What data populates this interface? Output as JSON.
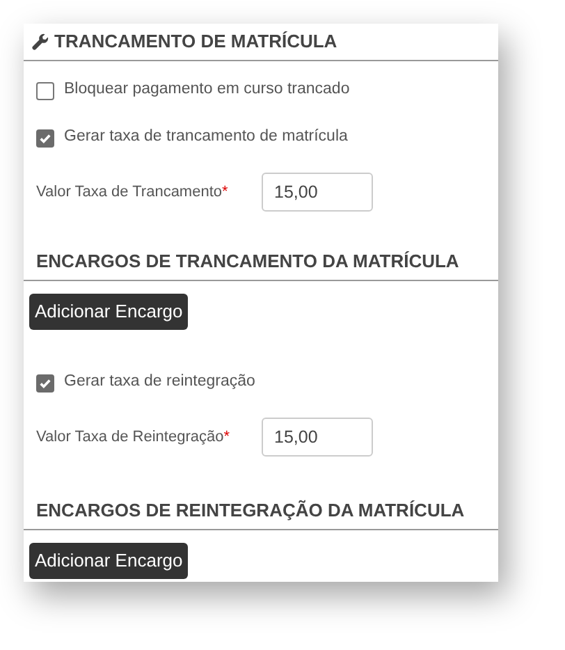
{
  "sections": [
    {
      "title": "TRANCAMENTO DE MATRÍCULA",
      "has_icon": true,
      "items": [
        {
          "kind": "checkbox",
          "label": "Bloquear pagamento em curso trancado",
          "checked": false
        },
        {
          "kind": "checkbox",
          "label": "Gerar taxa de trancamento de matrícula",
          "checked": true
        },
        {
          "kind": "field",
          "label": "Valor Taxa de Trancamento",
          "required_mark": "*",
          "value": "15,00"
        }
      ]
    },
    {
      "title": "ENCARGOS DE TRANCAMENTO DA MATRÍCULA",
      "has_icon": false,
      "items": [
        {
          "kind": "button",
          "label": "Adicionar Encargo"
        },
        {
          "kind": "checkbox",
          "label": "Gerar taxa de reintegração",
          "checked": true
        },
        {
          "kind": "field",
          "label": "Valor Taxa de Reintegração",
          "required_mark": "*",
          "value": "15,00"
        }
      ]
    },
    {
      "title": "ENCARGOS DE REINTEGRAÇÃO DA MATRÍCULA",
      "has_icon": false,
      "items": [
        {
          "kind": "button",
          "label": "Adicionar Encargo"
        }
      ]
    }
  ]
}
